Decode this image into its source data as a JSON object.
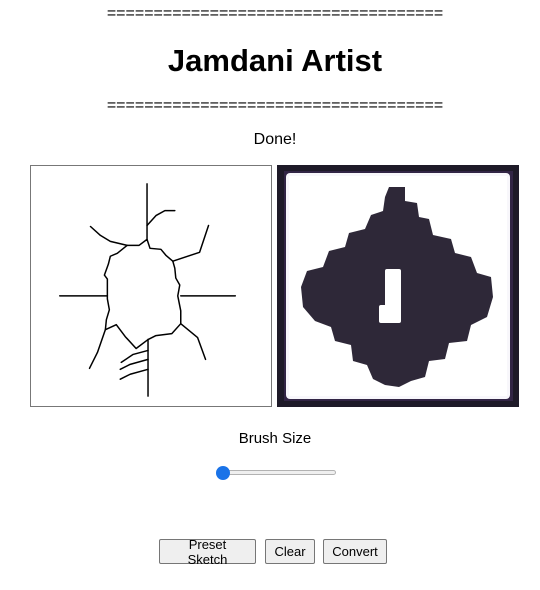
{
  "header": {
    "divider_top": "====================================",
    "title": "Jamdani Artist",
    "divider_bottom": "===================================="
  },
  "status": "Done!",
  "controls": {
    "brush_label": "Brush Size",
    "brush_size_fraction": 0.0
  },
  "buttons": {
    "preset": "Preset Sketch",
    "clear": "Clear",
    "convert": "Convert"
  },
  "colors": {
    "accent": "#1a73e8",
    "output_bg": "#1e1a28",
    "motif": "#2e2838",
    "button_bg": "#efefef"
  }
}
